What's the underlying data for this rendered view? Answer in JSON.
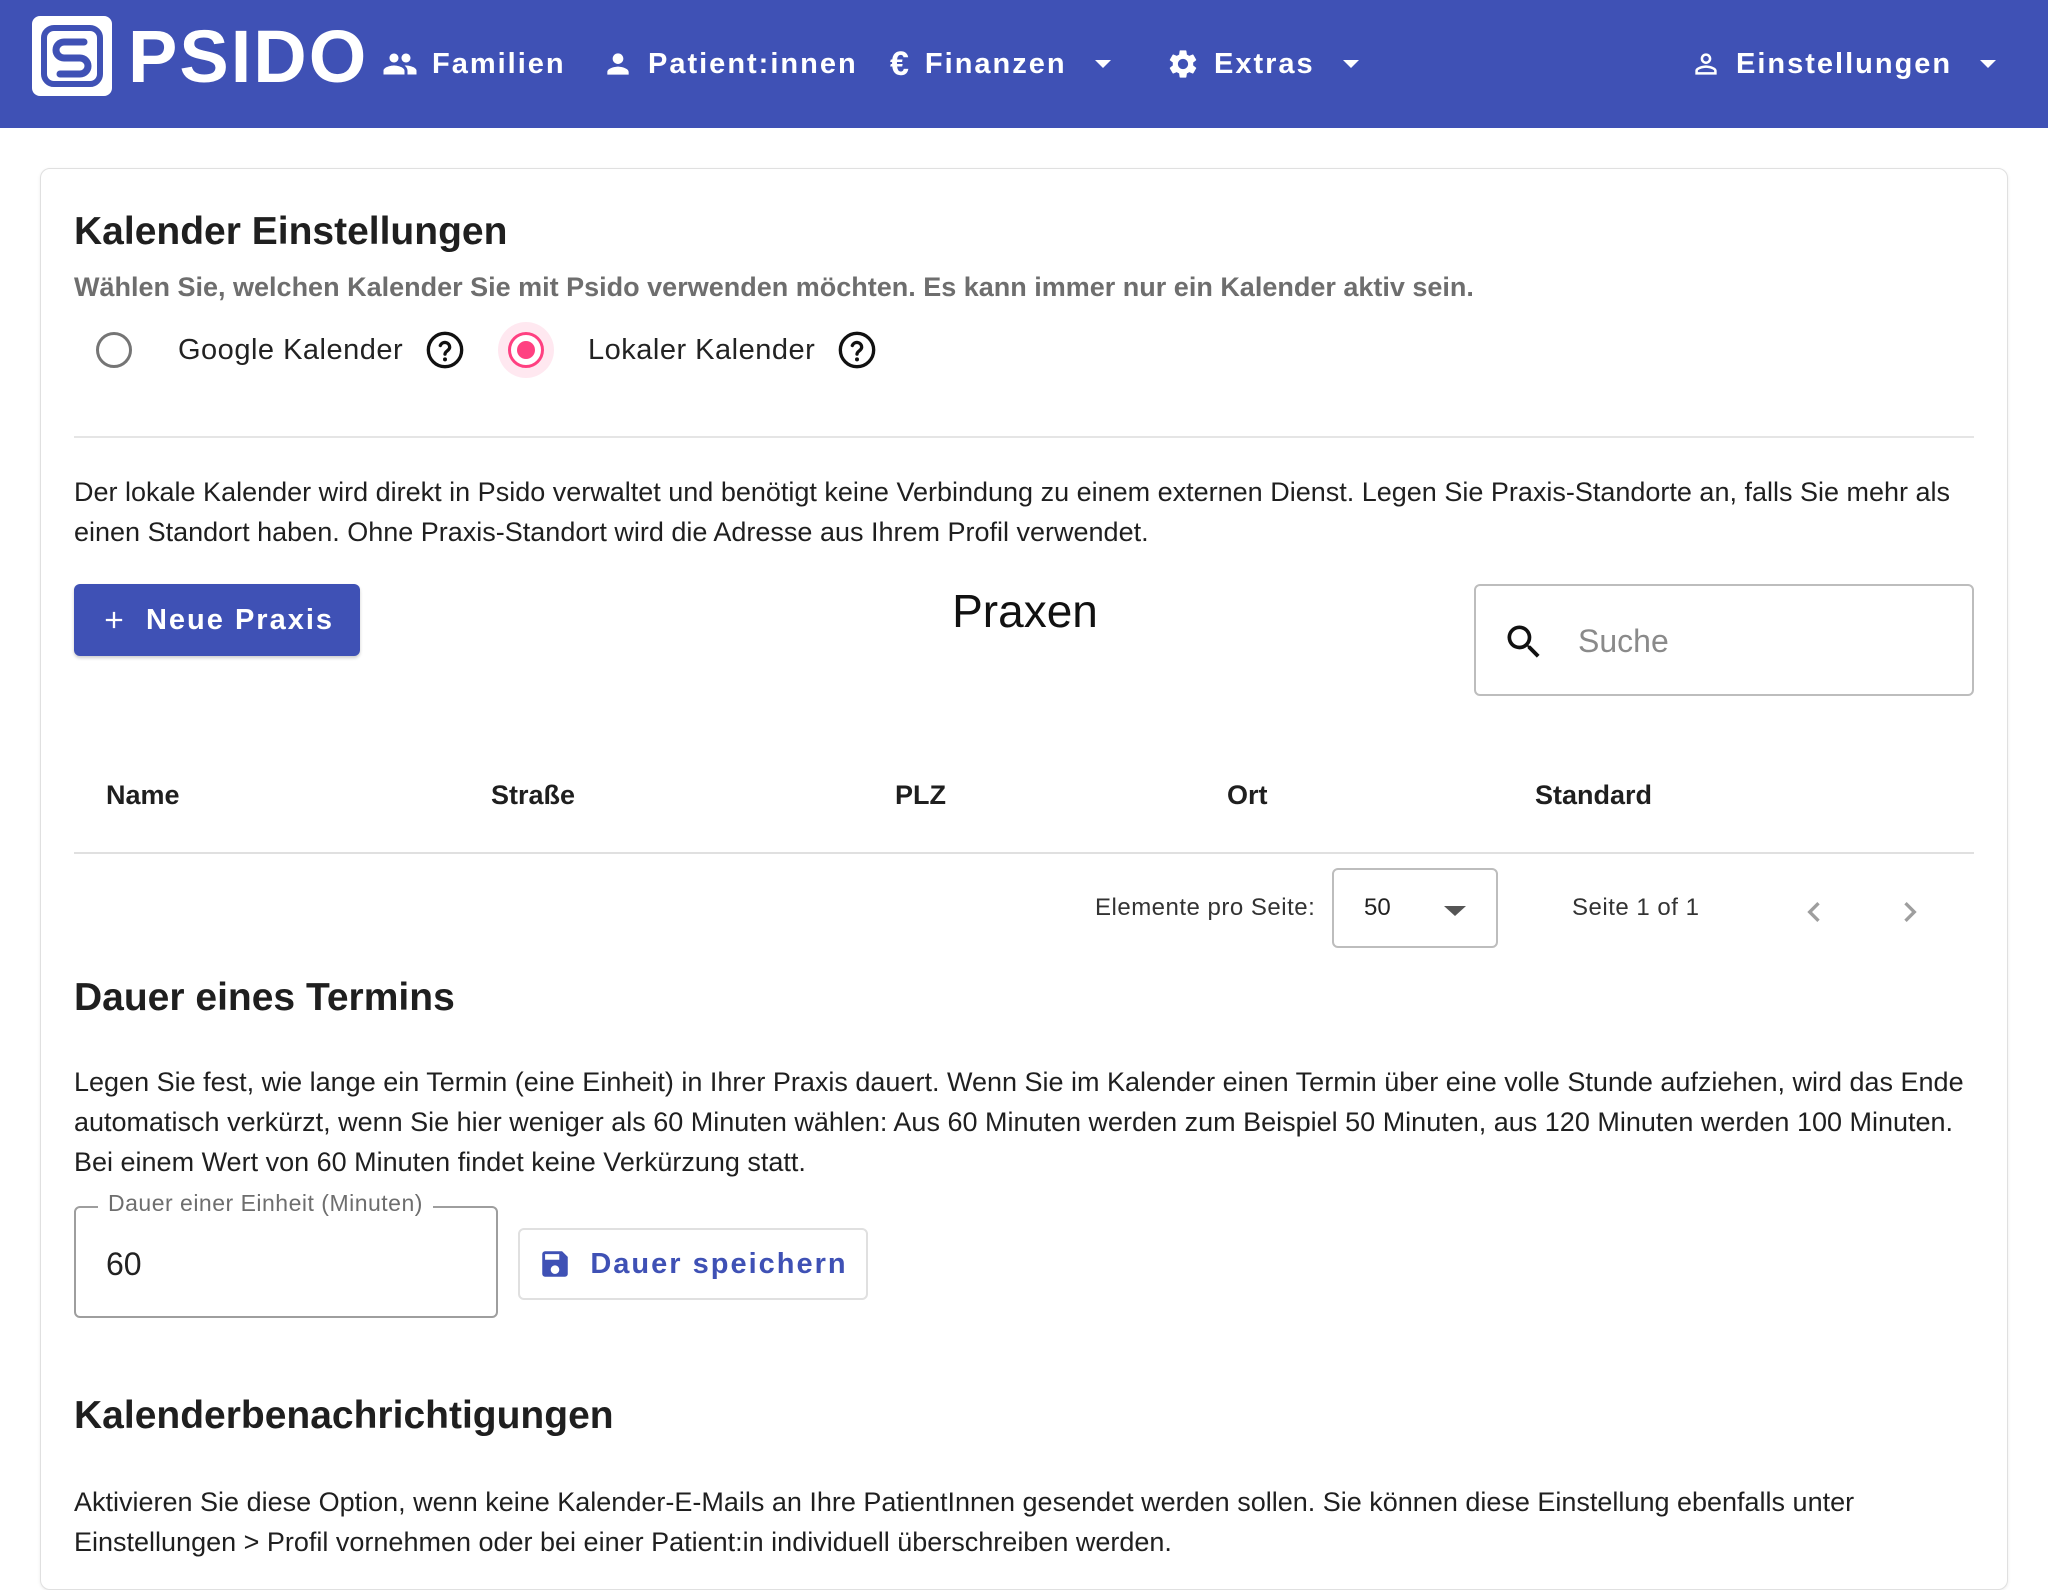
{
  "app": {
    "name": "PSIDO"
  },
  "nav": {
    "familien": "Familien",
    "patienten": "Patient:innen",
    "finanzen": "Finanzen",
    "extras": "Extras",
    "einstellungen": "Einstellungen"
  },
  "calendar": {
    "title": "Kalender Einstellungen",
    "subtitle": "Wählen Sie, welchen Kalender Sie mit Psido verwenden möchten. Es kann immer nur ein Kalender aktiv sein.",
    "options": [
      {
        "label": "Google Kalender",
        "selected": false
      },
      {
        "label": "Lokaler Kalender",
        "selected": true
      }
    ],
    "description": "Der lokale Kalender wird direkt in Psido verwaltet und benötigt keine Verbindung zu einem externen Dienst. Legen Sie Praxis-Standorte an, falls Sie mehr als einen Standort haben. Ohne Praxis-Standort wird die Adresse aus Ihrem Profil verwendet."
  },
  "praxen": {
    "new_button": "Neue Praxis",
    "title": "Praxen",
    "search_placeholder": "Suche",
    "columns": [
      "Name",
      "Straße",
      "PLZ",
      "Ort",
      "Standard"
    ],
    "rows": [],
    "pagination": {
      "per_page_label": "Elemente pro Seite:",
      "per_page_value": "50",
      "page_text": "Seite 1 of 1"
    }
  },
  "duration": {
    "title": "Dauer eines Termins",
    "description": "Legen Sie fest, wie lange ein Termin (eine Einheit) in Ihrer Praxis dauert. Wenn Sie im Kalender einen Termin über eine volle Stunde aufziehen, wird das Ende automatisch verkürzt, wenn Sie hier weniger als 60 Minuten wählen: Aus 60 Minuten werden zum Beispiel 50 Minuten, aus 120 Minuten werden 100 Minuten. Bei einem Wert von 60 Minuten findet keine Verkürzung statt.",
    "field_label": "Dauer einer Einheit (Minuten)",
    "field_value": "60",
    "save_button": "Dauer speichern"
  },
  "notifications": {
    "title": "Kalenderbenachrichtigungen",
    "description": "Aktivieren Sie diese Option, wenn keine Kalender-E-Mails an Ihre PatientInnen gesendet werden sollen. Sie können diese Einstellung ebenfalls unter Einstellungen > Profil vornehmen oder bei einer Patient:in individuell überschreiben werden."
  },
  "colors": {
    "primary": "#3f51b5",
    "accent": "#ff4081"
  }
}
